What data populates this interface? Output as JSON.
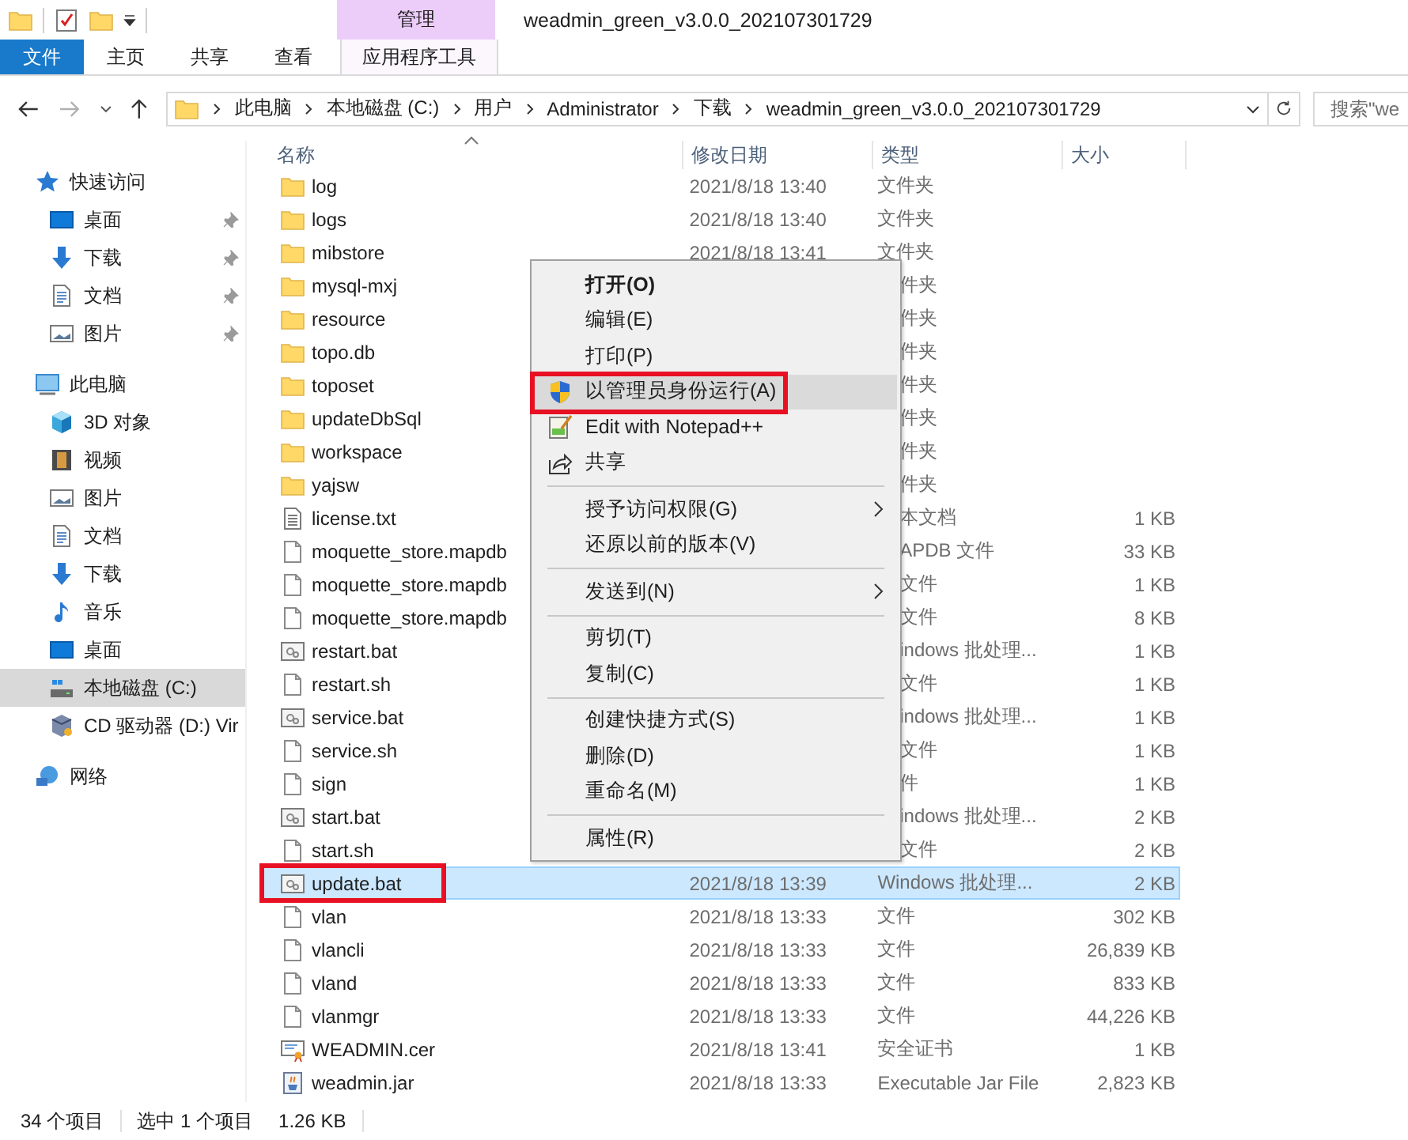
{
  "window": {
    "title": "weadmin_green_v3.0.0_202107301729"
  },
  "ribbon": {
    "context_group": "管理",
    "tabs": [
      {
        "label": "文件",
        "kind": "file"
      },
      {
        "label": "主页",
        "kind": "normal"
      },
      {
        "label": "共享",
        "kind": "normal"
      },
      {
        "label": "查看",
        "kind": "normal"
      },
      {
        "label": "应用程序工具",
        "kind": "context"
      }
    ]
  },
  "address": {
    "crumbs": [
      "此电脑",
      "本地磁盘 (C:)",
      "用户",
      "Administrator",
      "下载",
      "weadmin_green_v3.0.0_202107301729"
    ]
  },
  "search": {
    "placeholder": "搜索\"we"
  },
  "sidebar": {
    "items": [
      {
        "label": "快速访问",
        "kind": "star",
        "selected": false,
        "children": [
          {
            "label": "桌面",
            "kind": "desktop",
            "selected": false,
            "pinned": true
          },
          {
            "label": "下载",
            "kind": "download",
            "selected": false,
            "pinned": true
          },
          {
            "label": "文档",
            "kind": "document",
            "selected": false,
            "pinned": true
          },
          {
            "label": "图片",
            "kind": "picture",
            "selected": false,
            "pinned": true
          }
        ]
      },
      {
        "label": "此电脑",
        "kind": "pc",
        "selected": false,
        "children": [
          {
            "label": "3D 对象",
            "kind": "cube",
            "selected": false
          },
          {
            "label": "视频",
            "kind": "video",
            "selected": false
          },
          {
            "label": "图片",
            "kind": "picture",
            "selected": false
          },
          {
            "label": "文档",
            "kind": "document",
            "selected": false
          },
          {
            "label": "下载",
            "kind": "download",
            "selected": false
          },
          {
            "label": "音乐",
            "kind": "music",
            "selected": false
          },
          {
            "label": "桌面",
            "kind": "desktop",
            "selected": false
          },
          {
            "label": "本地磁盘 (C:)",
            "kind": "drive",
            "selected": true
          },
          {
            "label": "CD 驱动器 (D:) Vir",
            "kind": "cd",
            "selected": false
          }
        ]
      },
      {
        "label": "网络",
        "kind": "network",
        "selected": false
      }
    ]
  },
  "file_list": {
    "columns": [
      "名称",
      "修改日期",
      "类型",
      "大小"
    ],
    "rows": [
      {
        "name": "log",
        "kind": "folder",
        "date": "2021/8/18 13:40",
        "type": "文件夹",
        "selected": false,
        "highlighted": false
      },
      {
        "name": "logs",
        "kind": "folder",
        "date": "2021/8/18 13:40",
        "type": "文件夹",
        "selected": false,
        "highlighted": false
      },
      {
        "name": "mibstore",
        "kind": "folder",
        "date": "2021/8/18 13:41",
        "type": "文件夹",
        "selected": false,
        "highlighted": false
      },
      {
        "name": "mysql-mxj",
        "kind": "folder",
        "type": "件夹",
        "selected": false,
        "highlighted": false
      },
      {
        "name": "resource",
        "kind": "folder",
        "type": "件夹",
        "selected": false,
        "highlighted": false
      },
      {
        "name": "topo.db",
        "kind": "folder",
        "type": "件夹",
        "selected": false,
        "highlighted": false
      },
      {
        "name": "toposet",
        "kind": "folder",
        "type": "件夹",
        "selected": false,
        "highlighted": false
      },
      {
        "name": "updateDbSql",
        "kind": "folder",
        "type": "件夹",
        "selected": false,
        "highlighted": false
      },
      {
        "name": "workspace",
        "kind": "folder",
        "type": "件夹",
        "selected": false,
        "highlighted": false
      },
      {
        "name": "yajsw",
        "kind": "folder",
        "type": "件夹",
        "selected": false,
        "highlighted": false
      },
      {
        "name": "license.txt",
        "kind": "text",
        "type": "本文档",
        "size": "1 KB",
        "selected": false,
        "highlighted": false
      },
      {
        "name": "moquette_store.mapdb",
        "kind": "file",
        "type": "APDB 文件",
        "size": "33 KB",
        "selected": false,
        "highlighted": false
      },
      {
        "name": "moquette_store.mapdb",
        "kind": "file",
        "type": "文件",
        "size": "1 KB",
        "selected": false,
        "highlighted": false
      },
      {
        "name": "moquette_store.mapdb",
        "kind": "file",
        "type": "文件",
        "size": "8 KB",
        "selected": false,
        "highlighted": false
      },
      {
        "name": "restart.bat",
        "kind": "bat",
        "type": "indows 批处理...",
        "size": "1 KB",
        "selected": false,
        "highlighted": false
      },
      {
        "name": "restart.sh",
        "kind": "file",
        "type": "文件",
        "size": "1 KB",
        "selected": false,
        "highlighted": false
      },
      {
        "name": "service.bat",
        "kind": "bat",
        "type": "indows 批处理...",
        "size": "1 KB",
        "selected": false,
        "highlighted": false
      },
      {
        "name": "service.sh",
        "kind": "file",
        "type": "文件",
        "size": "1 KB",
        "selected": false,
        "highlighted": false
      },
      {
        "name": "sign",
        "kind": "file",
        "type": "件",
        "size": "1 KB",
        "selected": false,
        "highlighted": false
      },
      {
        "name": "start.bat",
        "kind": "bat",
        "type": "indows 批处理...",
        "size": "2 KB",
        "selected": false,
        "highlighted": false
      },
      {
        "name": "start.sh",
        "kind": "file",
        "type": "文件",
        "size": "2 KB",
        "selected": false,
        "highlighted": false
      },
      {
        "name": "update.bat",
        "kind": "bat",
        "date": "2021/8/18 13:39",
        "type": "Windows 批处理...",
        "size": "2 KB",
        "selected": true,
        "highlighted": true
      },
      {
        "name": "vlan",
        "kind": "file",
        "date": "2021/8/18 13:33",
        "type": "文件",
        "size": "302 KB",
        "selected": false,
        "highlighted": false
      },
      {
        "name": "vlancli",
        "kind": "file",
        "date": "2021/8/18 13:33",
        "type": "文件",
        "size": "26,839 KB",
        "selected": false,
        "highlighted": false
      },
      {
        "name": "vland",
        "kind": "file",
        "date": "2021/8/18 13:33",
        "type": "文件",
        "size": "833 KB",
        "selected": false,
        "highlighted": false
      },
      {
        "name": "vlanmgr",
        "kind": "file",
        "date": "2021/8/18 13:33",
        "type": "文件",
        "size": "44,226 KB",
        "selected": false,
        "highlighted": false
      },
      {
        "name": "WEADMIN.cer",
        "kind": "cert",
        "date": "2021/8/18 13:41",
        "type": "安全证书",
        "size": "1 KB",
        "selected": false,
        "highlighted": false
      },
      {
        "name": "weadmin.jar",
        "kind": "jar",
        "date": "2021/8/18 13:33",
        "type": "Executable Jar File",
        "size": "2,823 KB",
        "selected": false,
        "highlighted": false
      }
    ]
  },
  "context_menu": {
    "items": [
      {
        "kind": "item",
        "label": "打开(O)",
        "default": true,
        "hovered": false,
        "highlighted": false,
        "submenu": false
      },
      {
        "kind": "item",
        "label": "编辑(E)",
        "default": false,
        "hovered": false,
        "highlighted": false,
        "submenu": false
      },
      {
        "kind": "item",
        "label": "打印(P)",
        "default": false,
        "hovered": false,
        "highlighted": false,
        "submenu": false
      },
      {
        "kind": "shield_item",
        "label": "以管理员身份运行(A)",
        "default": false,
        "hovered": true,
        "highlighted": true,
        "submenu": false
      },
      {
        "kind": "notepad_item",
        "label": "Edit with Notepad++",
        "default": false,
        "hovered": false,
        "highlighted": false,
        "submenu": false
      },
      {
        "kind": "share_item",
        "label": "共享",
        "default": false,
        "hovered": false,
        "highlighted": false,
        "submenu": false
      },
      {
        "kind": "separator"
      },
      {
        "kind": "item",
        "label": "授予访问权限(G)",
        "default": false,
        "hovered": false,
        "highlighted": false,
        "submenu": true
      },
      {
        "kind": "item",
        "label": "还原以前的版本(V)",
        "default": false,
        "hovered": false,
        "highlighted": false,
        "submenu": false
      },
      {
        "kind": "separator"
      },
      {
        "kind": "item",
        "label": "发送到(N)",
        "default": false,
        "hovered": false,
        "highlighted": false,
        "submenu": true
      },
      {
        "kind": "separator"
      },
      {
        "kind": "item",
        "label": "剪切(T)",
        "default": false,
        "hovered": false,
        "highlighted": false,
        "submenu": false
      },
      {
        "kind": "item",
        "label": "复制(C)",
        "default": false,
        "hovered": false,
        "highlighted": false,
        "submenu": false
      },
      {
        "kind": "separator"
      },
      {
        "kind": "item",
        "label": "创建快捷方式(S)",
        "default": false,
        "hovered": false,
        "highlighted": false,
        "submenu": false
      },
      {
        "kind": "item",
        "label": "删除(D)",
        "default": false,
        "hovered": false,
        "highlighted": false,
        "submenu": false
      },
      {
        "kind": "item",
        "label": "重命名(M)",
        "default": false,
        "hovered": false,
        "highlighted": false,
        "submenu": false
      },
      {
        "kind": "separator"
      },
      {
        "kind": "item",
        "label": "属性(R)",
        "default": false,
        "hovered": false,
        "highlighted": false,
        "submenu": false
      }
    ]
  },
  "status_bar": {
    "item_count": "34 个项目",
    "selection": "选中 1 个项目",
    "selection_size": "1.26 KB"
  }
}
